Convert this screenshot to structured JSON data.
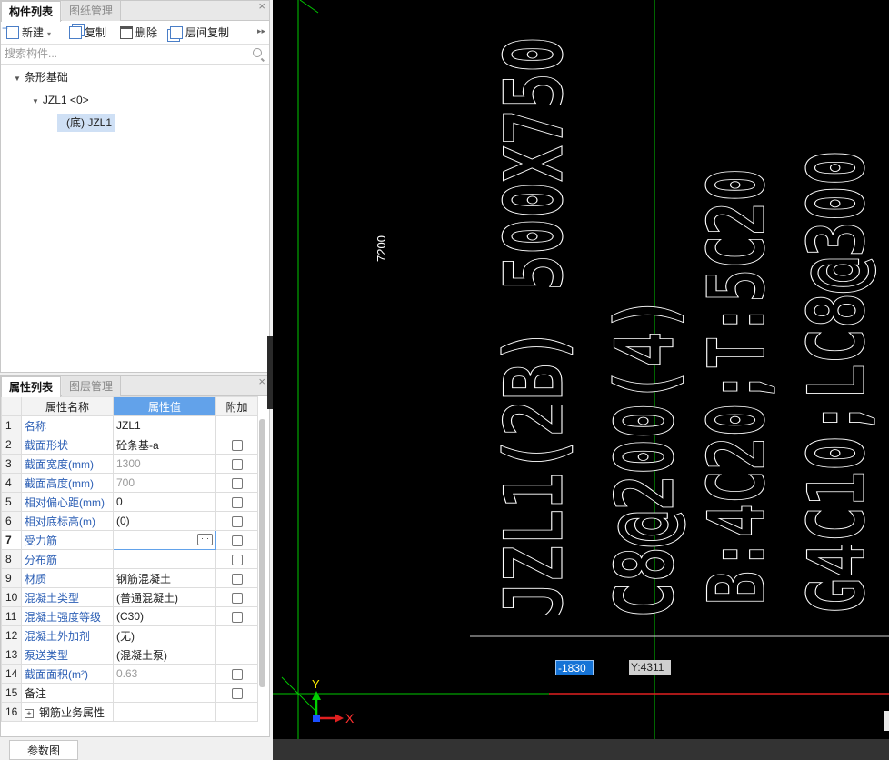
{
  "component_panel": {
    "tabs": [
      "构件列表",
      "图纸管理"
    ],
    "close": "×",
    "toolbar": {
      "new_label": "新建",
      "copy_label": "复制",
      "delete_label": "删除",
      "floor_copy_label": "层间复制",
      "more": "▸▸"
    },
    "search_placeholder": "搜索构件...",
    "tree": {
      "root": "条形基础",
      "child": "JZL1 <0>",
      "leaf": "(底) JZL1"
    }
  },
  "property_panel": {
    "tabs": [
      "属性列表",
      "图层管理"
    ],
    "close": "×",
    "headers": {
      "name": "属性名称",
      "value": "属性值",
      "extra": "附加"
    },
    "rows": [
      {
        "num": "1",
        "name": "名称",
        "value": "JZL1",
        "checkbox": false
      },
      {
        "num": "2",
        "name": "截面形状",
        "value": "砼条基-a",
        "checkbox": true
      },
      {
        "num": "3",
        "name": "截面宽度(mm)",
        "value": "1300",
        "checkbox": true
      },
      {
        "num": "4",
        "name": "截面高度(mm)",
        "value": "700",
        "checkbox": true
      },
      {
        "num": "5",
        "name": "相对偏心距(mm)",
        "value": "0",
        "checkbox": true
      },
      {
        "num": "6",
        "name": "相对底标高(m)",
        "value": "(0)",
        "checkbox": true
      },
      {
        "num": "7",
        "name": "受力筋",
        "value": "",
        "checkbox": true
      },
      {
        "num": "8",
        "name": "分布筋",
        "value": "",
        "checkbox": true
      },
      {
        "num": "9",
        "name": "材质",
        "value": "钢筋混凝土",
        "checkbox": true
      },
      {
        "num": "10",
        "name": "混凝土类型",
        "value": "(普通混凝土)",
        "checkbox": true
      },
      {
        "num": "11",
        "name": "混凝土强度等级",
        "value": "(C30)",
        "checkbox": true
      },
      {
        "num": "12",
        "name": "混凝土外加剂",
        "value": "(无)",
        "checkbox": false
      },
      {
        "num": "13",
        "name": "泵送类型",
        "value": "(混凝土泵)",
        "checkbox": false
      },
      {
        "num": "14",
        "name": "截面面积(m²)",
        "value": "0.63",
        "checkbox": true
      },
      {
        "num": "15",
        "name": "备注",
        "value": "",
        "checkbox": true
      },
      {
        "num": "16",
        "name": "钢筋业务属性",
        "value": "",
        "checkbox": false
      }
    ],
    "ellipsis": "···"
  },
  "bottom_tab": "参数图",
  "canvas": {
    "dimension_text": "7200",
    "annotations": [
      "JZL1(2B) 500X750",
      "C8@200(4)",
      "B:4C20;T:5C20",
      "G4C10;LC8@300"
    ],
    "coord_x": "-1830",
    "coord_y": "Y:4311",
    "axis_x": "X",
    "axis_y": "Y",
    "colors": {
      "background": "#000000",
      "grid_line": "#00c800",
      "text": "#ffffff",
      "coord_x_bg": "#1573d6",
      "header_accent": "#62a2ea"
    }
  }
}
